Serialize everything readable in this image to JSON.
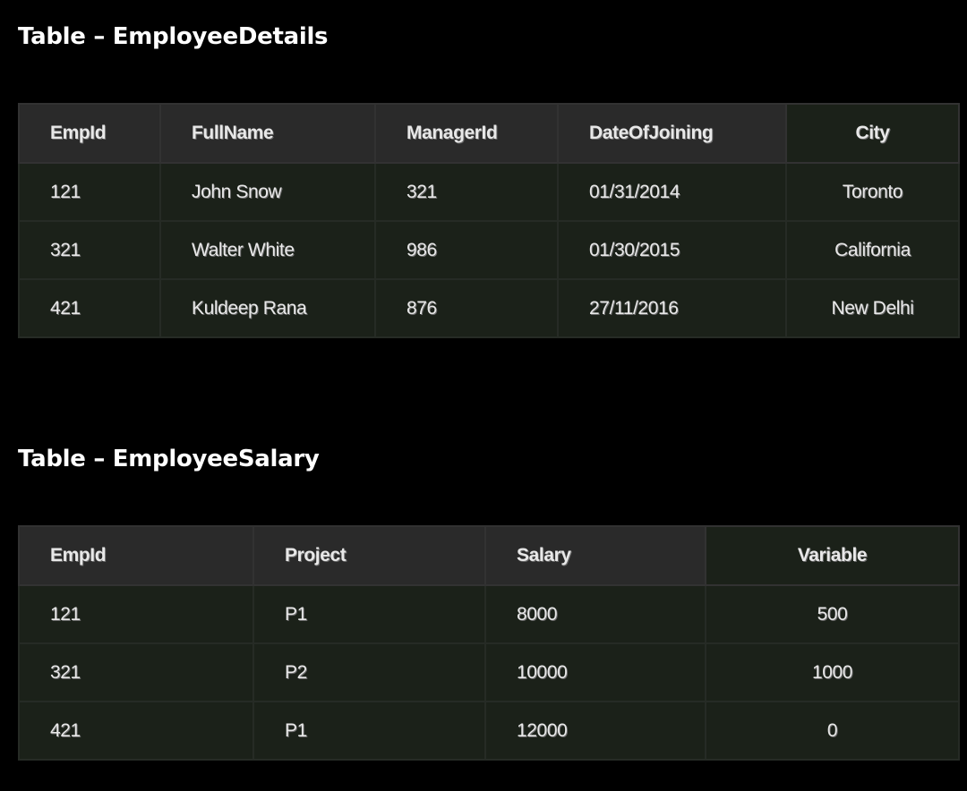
{
  "tables": [
    {
      "title": "Table – EmployeeDetails",
      "headers": [
        "EmpId",
        "FullName",
        "ManagerId",
        "DateOfJoining",
        "City"
      ],
      "rows": [
        [
          "121",
          "John Snow",
          "321",
          "01/31/2014",
          "Toronto"
        ],
        [
          "321",
          "Walter White",
          "986",
          "01/30/2015",
          "California"
        ],
        [
          "421",
          "Kuldeep Rana",
          "876",
          "27/11/2016",
          "New Delhi"
        ]
      ]
    },
    {
      "title": "Table – EmployeeSalary",
      "headers": [
        "EmpId",
        "Project",
        "Salary",
        "Variable"
      ],
      "rows": [
        [
          "121",
          "P1",
          "8000",
          "500"
        ],
        [
          "321",
          "P2",
          "10000",
          "1000"
        ],
        [
          "421",
          "P1",
          "12000",
          "0"
        ]
      ]
    }
  ],
  "colors": {
    "background": "#000000",
    "header_bg": "#2a2a2a",
    "cell_bg": "#1b2119",
    "text": "#e8e8e8"
  }
}
